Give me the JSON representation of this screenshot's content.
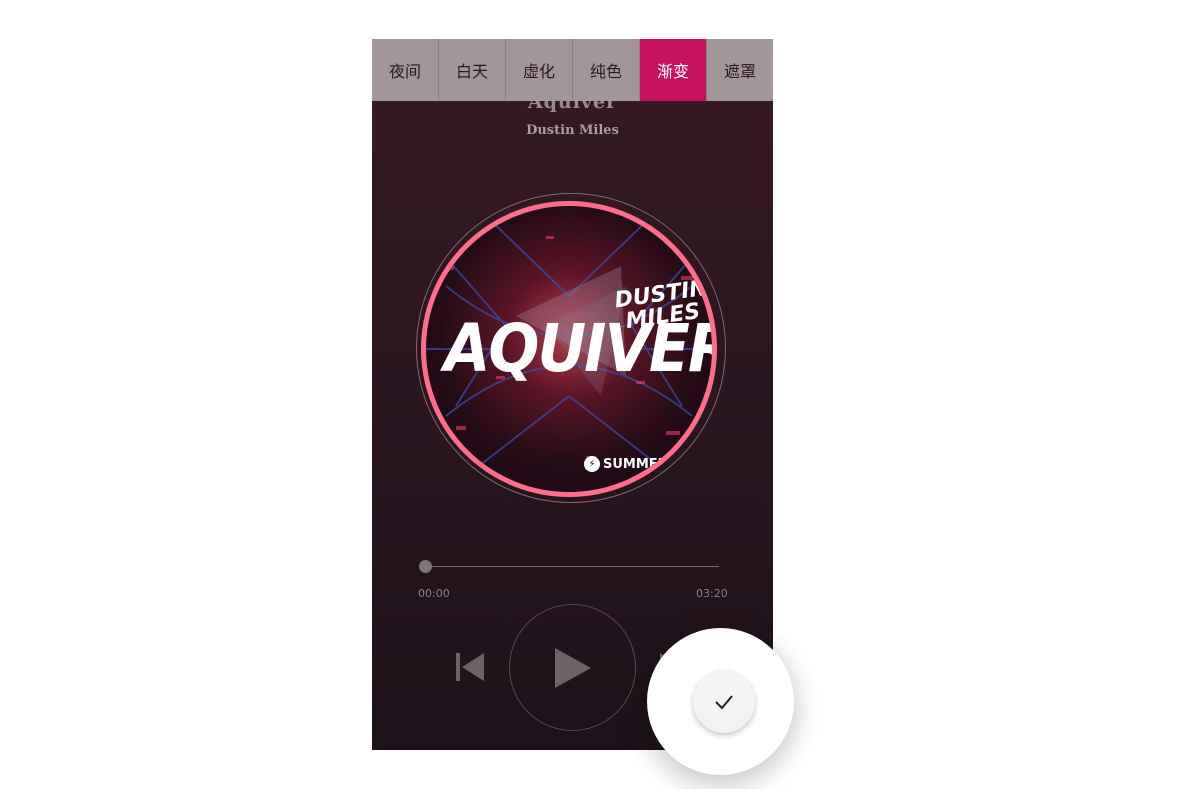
{
  "tabs": [
    {
      "label": "夜间",
      "active": false
    },
    {
      "label": "白天",
      "active": false
    },
    {
      "label": "虚化",
      "active": false
    },
    {
      "label": "纯色",
      "active": false
    },
    {
      "label": "渐变",
      "active": true
    },
    {
      "label": "遮罩",
      "active": false
    }
  ],
  "song": {
    "title": "Aquiver",
    "artist": "Dustin Miles"
  },
  "cover": {
    "title": "AQUIVER",
    "artist_line1": "DUSTIN",
    "artist_line2": "MILES",
    "label": "SUMMER"
  },
  "player": {
    "current_time": "00:00",
    "total_time": "03:20",
    "progress": 0
  },
  "icons": {
    "prev": "skip-previous-icon",
    "play": "play-icon",
    "next": "skip-next-icon",
    "confirm": "check-icon"
  },
  "colors": {
    "accent": "#c8125f",
    "disc_ring": "#ff6d8d",
    "tab_bar": "#a29699",
    "background_top": "#371a22",
    "background_bottom": "#1d1219"
  }
}
